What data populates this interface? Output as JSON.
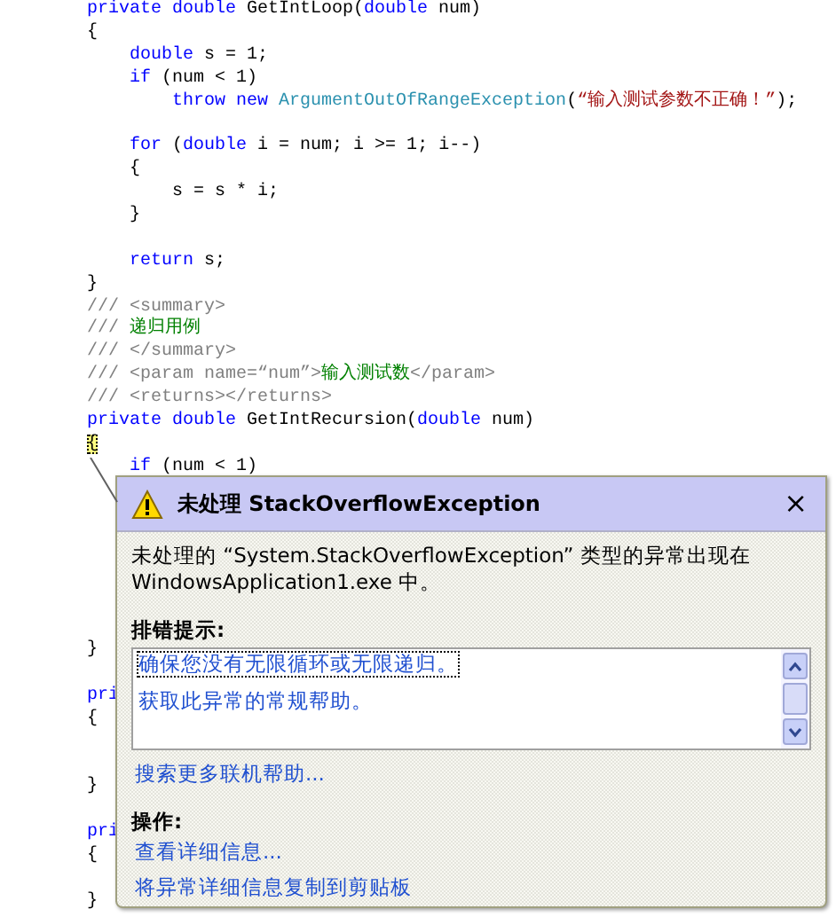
{
  "code_lines": [
    {
      "kind": "code",
      "tokens": [
        {
          "kind": "keyword",
          "text": "private double "
        },
        {
          "kind": "plain",
          "text": "GetIntLoop("
        },
        {
          "kind": "keyword",
          "text": "double"
        },
        {
          "kind": "plain",
          "text": " num)"
        }
      ]
    },
    {
      "kind": "code",
      "tokens": [
        {
          "kind": "plain",
          "text": "{"
        }
      ]
    },
    {
      "kind": "code",
      "tokens": [
        {
          "kind": "keyword",
          "text": "    double"
        },
        {
          "kind": "plain",
          "text": " s = 1;"
        }
      ]
    },
    {
      "kind": "code",
      "tokens": [
        {
          "kind": "keyword",
          "text": "    if"
        },
        {
          "kind": "plain",
          "text": " (num < 1)"
        }
      ]
    },
    {
      "kind": "code",
      "tokens": [
        {
          "kind": "keyword",
          "text": "        throw new "
        },
        {
          "kind": "type",
          "text": "ArgumentOutOfRangeException"
        },
        {
          "kind": "plain",
          "text": "("
        },
        {
          "kind": "string",
          "text": "“输入测试参数不正确！”"
        },
        {
          "kind": "plain",
          "text": ");"
        }
      ]
    },
    {
      "kind": "blank"
    },
    {
      "kind": "code",
      "tokens": [
        {
          "kind": "keyword",
          "text": "    for"
        },
        {
          "kind": "plain",
          "text": " ("
        },
        {
          "kind": "keyword",
          "text": "double"
        },
        {
          "kind": "plain",
          "text": " i = num; i >= 1; i--)"
        }
      ]
    },
    {
      "kind": "code",
      "tokens": [
        {
          "kind": "plain",
          "text": "    {"
        }
      ]
    },
    {
      "kind": "code",
      "tokens": [
        {
          "kind": "plain",
          "text": "        s = s * i;"
        }
      ]
    },
    {
      "kind": "code",
      "tokens": [
        {
          "kind": "plain",
          "text": "    }"
        }
      ]
    },
    {
      "kind": "blank"
    },
    {
      "kind": "code",
      "tokens": [
        {
          "kind": "keyword",
          "text": "    return"
        },
        {
          "kind": "plain",
          "text": " s;"
        }
      ]
    },
    {
      "kind": "code",
      "tokens": [
        {
          "kind": "plain",
          "text": "}"
        }
      ]
    },
    {
      "kind": "code",
      "tokens": [
        {
          "kind": "doctag",
          "text": "/// <summary>"
        }
      ]
    },
    {
      "kind": "code",
      "tokens": [
        {
          "kind": "doctag",
          "text": "/// "
        },
        {
          "kind": "comment",
          "text": "递归用例"
        }
      ]
    },
    {
      "kind": "code",
      "tokens": [
        {
          "kind": "doctag",
          "text": "/// </summary>"
        }
      ]
    },
    {
      "kind": "code",
      "tokens": [
        {
          "kind": "doctag",
          "text": "/// <param name=“num”>"
        },
        {
          "kind": "comment",
          "text": "输入测试数"
        },
        {
          "kind": "doctag",
          "text": "</param>"
        }
      ]
    },
    {
      "kind": "code",
      "tokens": [
        {
          "kind": "doctag",
          "text": "/// <returns></returns>"
        }
      ]
    },
    {
      "kind": "code",
      "tokens": [
        {
          "kind": "keyword",
          "text": "private double "
        },
        {
          "kind": "plain",
          "text": "GetIntRecursion("
        },
        {
          "kind": "keyword",
          "text": "double"
        },
        {
          "kind": "plain",
          "text": " num)"
        }
      ]
    },
    {
      "kind": "code",
      "tokens": [
        {
          "kind": "current",
          "text": "{"
        }
      ]
    },
    {
      "kind": "code",
      "tokens": [
        {
          "kind": "keyword",
          "text": "    if"
        },
        {
          "kind": "plain",
          "text": " (num < 1)"
        }
      ]
    },
    {
      "kind": "blank"
    },
    {
      "kind": "blank"
    },
    {
      "kind": "blank"
    },
    {
      "kind": "blank"
    },
    {
      "kind": "blank"
    },
    {
      "kind": "blank"
    },
    {
      "kind": "blank"
    },
    {
      "kind": "code",
      "tokens": [
        {
          "kind": "plain",
          "text": "}"
        }
      ]
    },
    {
      "kind": "blank"
    },
    {
      "kind": "code",
      "tokens": [
        {
          "kind": "keyword",
          "text": "pri"
        }
      ]
    },
    {
      "kind": "code",
      "tokens": [
        {
          "kind": "plain",
          "text": "{"
        }
      ]
    },
    {
      "kind": "blank"
    },
    {
      "kind": "blank"
    },
    {
      "kind": "code",
      "tokens": [
        {
          "kind": "plain",
          "text": "}"
        }
      ]
    },
    {
      "kind": "blank"
    },
    {
      "kind": "code",
      "tokens": [
        {
          "kind": "keyword",
          "text": "pri"
        }
      ]
    },
    {
      "kind": "code",
      "tokens": [
        {
          "kind": "plain",
          "text": "{"
        }
      ]
    },
    {
      "kind": "blank"
    },
    {
      "kind": "code",
      "tokens": [
        {
          "kind": "plain",
          "text": "}"
        }
      ]
    }
  ],
  "exception_popup": {
    "title": "未处理 StackOverflowException",
    "close": "×",
    "message": "未处理的 “System.StackOverflowException” 类型的异常出现在 WindowsApplication1.exe 中。",
    "tips_heading": "排错提示:",
    "tips": [
      {
        "text": "确保您没有无限循环或无限递归。",
        "selected": true
      },
      {
        "text": "获取此异常的常规帮助。",
        "selected": false
      }
    ],
    "search_link": "搜索更多联机帮助...",
    "actions_heading": "操作:",
    "actions": [
      "查看详细信息...",
      "将异常详细信息复制到剪贴板"
    ]
  }
}
